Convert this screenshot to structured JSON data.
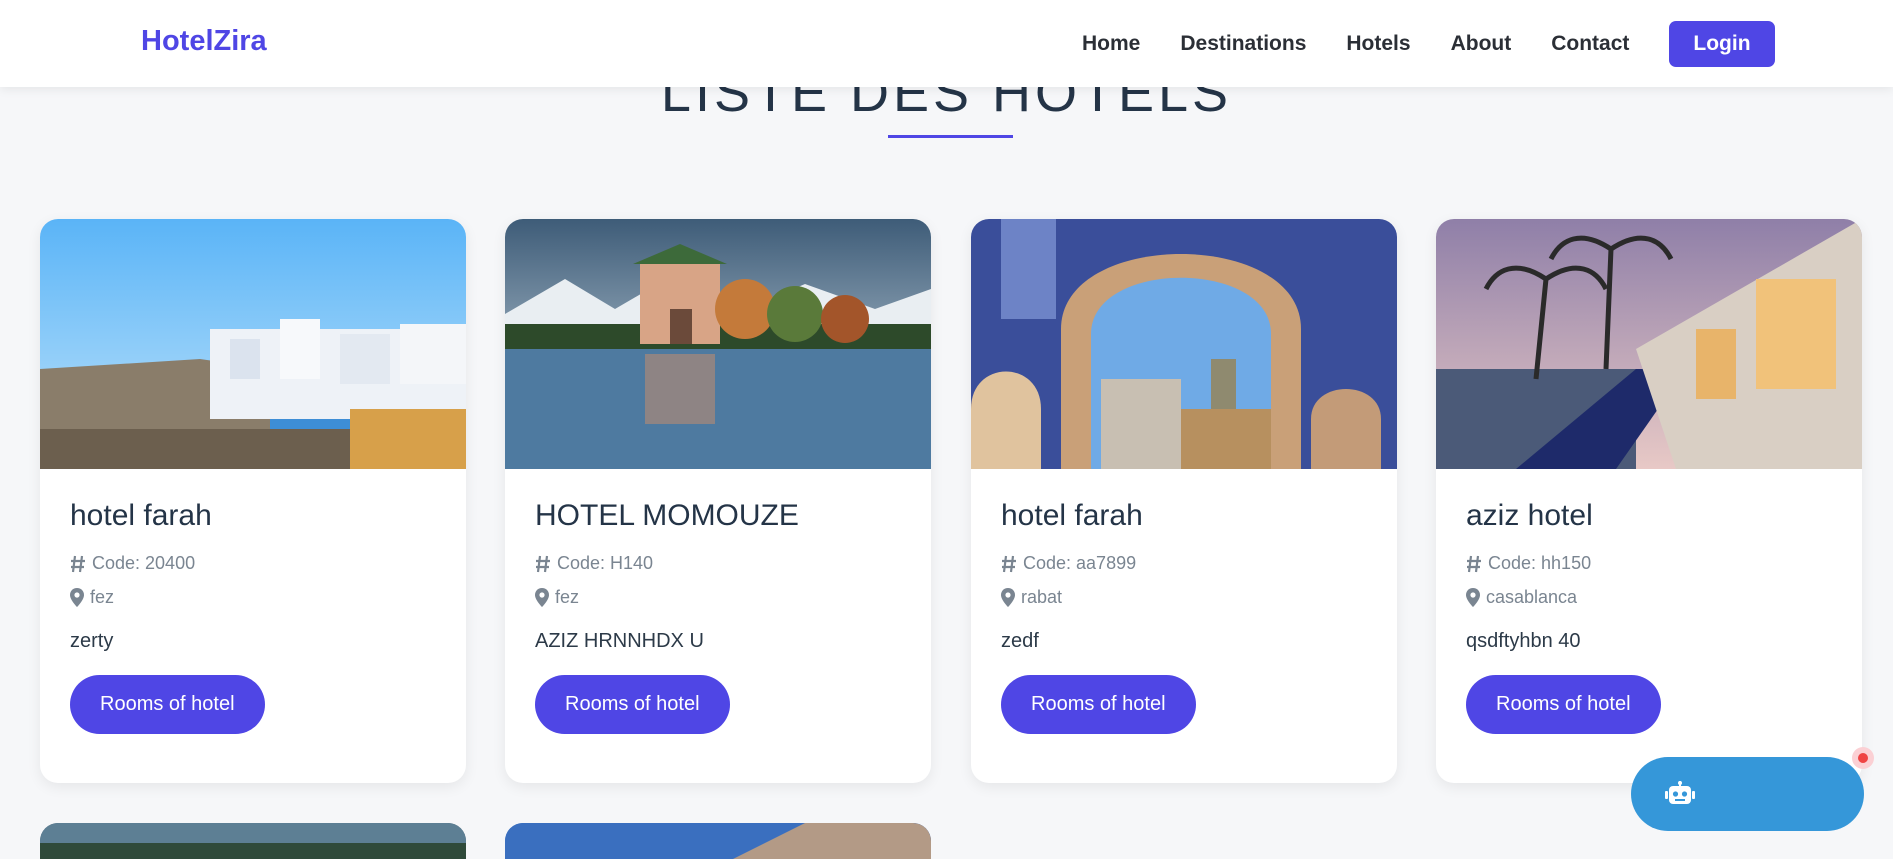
{
  "navbar": {
    "brand": "HotelZira",
    "links": [
      "Home",
      "Destinations",
      "Hotels",
      "About",
      "Contact"
    ],
    "login_label": "Login"
  },
  "section": {
    "title": "LISTE DES HOTELS"
  },
  "hotels": [
    {
      "name": "hotel farah",
      "code": "Code: 20400",
      "city": "fez",
      "description": "zerty",
      "button": "Rooms of hotel",
      "image": "essaouira-coast"
    },
    {
      "name": "HOTEL MOMOUZE",
      "code": "Code: H140",
      "city": "fez",
      "description": "AZIZ HRNNHDX U",
      "button": "Rooms of hotel",
      "image": "menara-pavilion"
    },
    {
      "name": "hotel farah",
      "code": "Code: aa7899",
      "city": "rabat",
      "description": "zedf",
      "button": "Rooms of hotel",
      "image": "fez-gate"
    },
    {
      "name": "aziz hotel",
      "code": "Code: hh150",
      "city": "casablanca",
      "description": "qsdftyhbn 40",
      "button": "Rooms of hotel",
      "image": "pool-palms"
    }
  ],
  "colors": {
    "brand": "#4f46e5",
    "chat": "#3597d9",
    "text": "#243447"
  }
}
